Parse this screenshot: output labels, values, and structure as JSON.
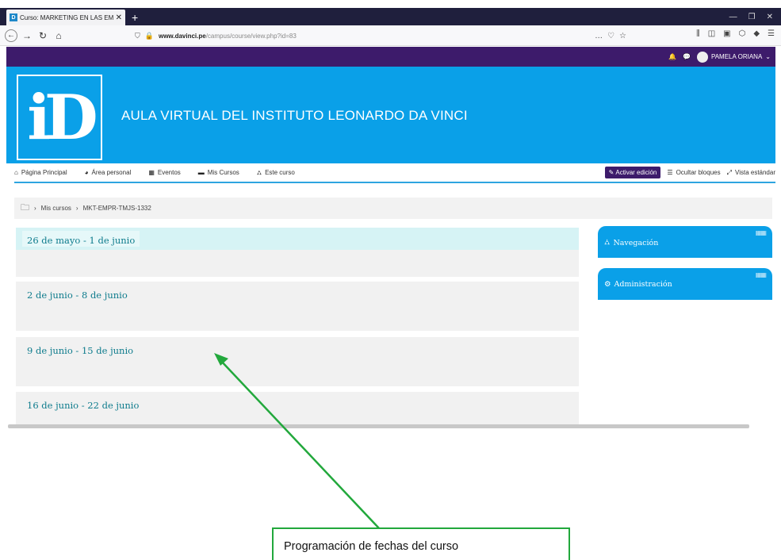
{
  "browser": {
    "tab_title": "Curso: MARKETING EN LAS EM",
    "tab_favicon": "D",
    "new_tab": "+",
    "url_host": "www.davinci.pe",
    "url_path": "/campus/course/view.php?id=83",
    "url_more": "…"
  },
  "moodle": {
    "user_name": "PAMELA ORIANA",
    "logo_letter": "iD",
    "site_title": "AULA VIRTUAL DEL INSTITUTO LEONARDO DA VINCI",
    "nav": [
      {
        "label": "Página Principal"
      },
      {
        "label": "Área personal"
      },
      {
        "label": "Eventos"
      },
      {
        "label": "Mis Cursos"
      },
      {
        "label": "Este curso"
      }
    ],
    "edit_button": "Activar edición",
    "hide_blocks": "Ocultar bloques",
    "standard_view": "Vista estándar",
    "breadcrumb": [
      "Mis cursos",
      "MKT-EMPR-TMJS-1332"
    ],
    "sections": [
      {
        "title": "26 de mayo - 1 de junio"
      },
      {
        "title": "2 de junio - 8 de junio"
      },
      {
        "title": "9 de junio - 15 de junio"
      },
      {
        "title": "16 de junio - 22 de junio"
      }
    ],
    "blocks": [
      {
        "title": "Navegación",
        "icon": "sitemap-icon"
      },
      {
        "title": "Administración",
        "icon": "cogs-icon"
      }
    ]
  },
  "annotation": {
    "text": "Programación de fechas del curso",
    "color": "#22a83c"
  },
  "colors": {
    "banner": "#0aa0e8",
    "topbar": "#3d1b6b",
    "section_title": "#0d7b8c"
  }
}
